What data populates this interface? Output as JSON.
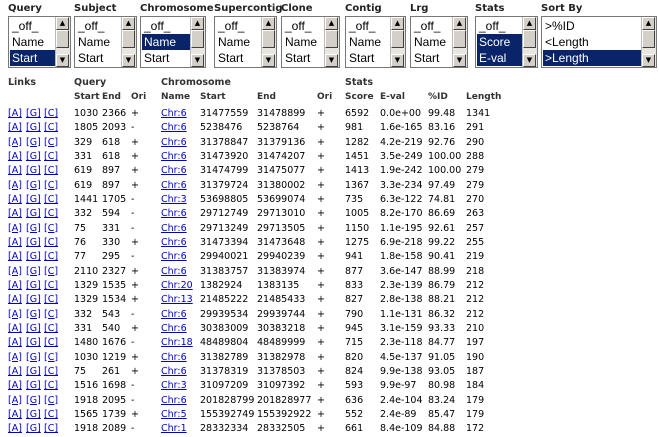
{
  "controls": [
    {
      "key": "query",
      "label": "Query",
      "options": [
        "_off_",
        "Name",
        "Start"
      ],
      "selected": [
        2
      ]
    },
    {
      "key": "subject",
      "label": "Subject",
      "options": [
        "_off_",
        "Name",
        "Start"
      ],
      "selected": []
    },
    {
      "key": "chromosome",
      "label": "Chromosome",
      "options": [
        "_off_",
        "Name",
        "Start"
      ],
      "selected": [
        1
      ]
    },
    {
      "key": "supercontig",
      "label": "Supercontig",
      "options": [
        "_off_",
        "Name",
        "Start"
      ],
      "selected": []
    },
    {
      "key": "clone",
      "label": "Clone",
      "options": [
        "_off_",
        "Name",
        "Start"
      ],
      "selected": []
    },
    {
      "key": "contig",
      "label": "Contig",
      "options": [
        "_off_",
        "Name",
        "Start"
      ],
      "selected": []
    },
    {
      "key": "lrg",
      "label": "Lrg",
      "options": [
        "_off_",
        "Name",
        "Start"
      ],
      "selected": []
    },
    {
      "key": "stats",
      "label": "Stats",
      "options": [
        "_off_",
        "Score",
        "E-val"
      ],
      "selected": [
        1,
        2
      ]
    },
    {
      "key": "sortby",
      "label": "Sort By",
      "options": [
        ">%ID",
        "<Length",
        ">Length"
      ],
      "selected": [
        2
      ]
    }
  ],
  "table": {
    "group_headers": {
      "links": "Links",
      "query": "Query",
      "chromosome": "Chromosome",
      "stats": "Stats"
    },
    "sub_headers": {
      "q_start": "Start",
      "q_end": "End",
      "q_ori": "Ori",
      "c_name": "Name",
      "c_start": "Start",
      "c_end": "End",
      "c_ori": "Ori",
      "score": "Score",
      "eval": "E-val",
      "pid": "%ID",
      "length": "Length"
    },
    "link_labels": [
      "[A]",
      "[G]",
      "[C]"
    ],
    "rows": [
      [
        "1030",
        "2366",
        "+",
        "Chr:6",
        "31477559",
        "31478899",
        "+",
        "6592",
        "0.0e+00",
        "99.48",
        "1341"
      ],
      [
        "1805",
        "2093",
        "-",
        "Chr:6",
        "5238476",
        "5238764",
        "+",
        "981",
        "1.6e-165",
        "83.16",
        "291"
      ],
      [
        "329",
        "618",
        "+",
        "Chr:6",
        "31378847",
        "31379136",
        "+",
        "1282",
        "4.2e-219",
        "92.76",
        "290"
      ],
      [
        "331",
        "618",
        "+",
        "Chr:6",
        "31473920",
        "31474207",
        "+",
        "1451",
        "3.5e-249",
        "100.00",
        "288"
      ],
      [
        "619",
        "897",
        "+",
        "Chr:6",
        "31474799",
        "31475077",
        "+",
        "1413",
        "1.9e-242",
        "100.00",
        "279"
      ],
      [
        "619",
        "897",
        "+",
        "Chr:6",
        "31379724",
        "31380002",
        "+",
        "1367",
        "3.3e-234",
        "97.49",
        "279"
      ],
      [
        "1441",
        "1705",
        "-",
        "Chr:3",
        "53698805",
        "53699074",
        "+",
        "735",
        "6.3e-122",
        "74.81",
        "270"
      ],
      [
        "332",
        "594",
        "-",
        "Chr:6",
        "29712749",
        "29713010",
        "+",
        "1005",
        "8.2e-170",
        "86.69",
        "263"
      ],
      [
        "75",
        "331",
        "-",
        "Chr:6",
        "29713249",
        "29713505",
        "+",
        "1150",
        "1.1e-195",
        "92.61",
        "257"
      ],
      [
        "76",
        "330",
        "+",
        "Chr:6",
        "31473394",
        "31473648",
        "+",
        "1275",
        "6.9e-218",
        "99.22",
        "255"
      ],
      [
        "77",
        "295",
        "-",
        "Chr:6",
        "29940021",
        "29940239",
        "+",
        "941",
        "1.8e-158",
        "90.41",
        "219"
      ],
      [
        "2110",
        "2327",
        "+",
        "Chr:6",
        "31383757",
        "31383974",
        "+",
        "877",
        "3.6e-147",
        "88.99",
        "218"
      ],
      [
        "1329",
        "1535",
        "+",
        "Chr:20",
        "1382924",
        "1383135",
        "+",
        "833",
        "2.3e-139",
        "86.79",
        "212"
      ],
      [
        "1329",
        "1534",
        "+",
        "Chr:13",
        "21485222",
        "21485433",
        "+",
        "827",
        "2.8e-138",
        "88.21",
        "212"
      ],
      [
        "332",
        "543",
        "-",
        "Chr:6",
        "29939534",
        "29939744",
        "+",
        "790",
        "1.1e-131",
        "86.32",
        "212"
      ],
      [
        "331",
        "540",
        "+",
        "Chr:6",
        "30383009",
        "30383218",
        "+",
        "945",
        "3.1e-159",
        "93.33",
        "210"
      ],
      [
        "1480",
        "1676",
        "-",
        "Chr:18",
        "48489804",
        "48489999",
        "+",
        "715",
        "2.3e-118",
        "84.77",
        "197"
      ],
      [
        "1030",
        "1219",
        "+",
        "Chr:6",
        "31382789",
        "31382978",
        "+",
        "820",
        "4.5e-137",
        "91.05",
        "190"
      ],
      [
        "75",
        "261",
        "+",
        "Chr:6",
        "31378319",
        "31378503",
        "+",
        "824",
        "9.9e-138",
        "93.05",
        "187"
      ],
      [
        "1516",
        "1698",
        "-",
        "Chr:3",
        "31097209",
        "31097392",
        "+",
        "593",
        "9.9e-97",
        "80.98",
        "184"
      ],
      [
        "1918",
        "2095",
        "-",
        "Chr:6",
        "201828799",
        "201828977",
        "+",
        "636",
        "2.4e-104",
        "83.24",
        "179"
      ],
      [
        "1565",
        "1739",
        "+",
        "Chr:5",
        "155392749",
        "155392922",
        "+",
        "552",
        "2.4e-89",
        "85.47",
        "179"
      ],
      [
        "1918",
        "2089",
        "-",
        "Chr:1",
        "28332334",
        "28332505",
        "+",
        "661",
        "8.4e-109",
        "84.88",
        "172"
      ]
    ]
  }
}
